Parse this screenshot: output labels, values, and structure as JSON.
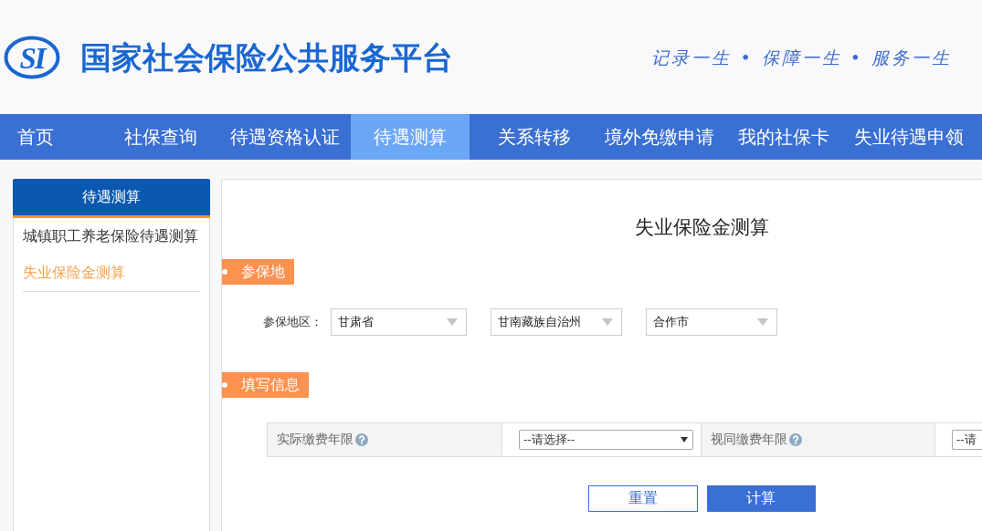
{
  "header": {
    "logo_text": "SI",
    "title": "国家社会保险公共服务平台",
    "slogan": "记录一生 • 保障一生 • 服务一生"
  },
  "nav": [
    {
      "label": "首页",
      "selected": false
    },
    {
      "label": "社保查询",
      "selected": false
    },
    {
      "label": "待遇资格认证",
      "selected": false
    },
    {
      "label": "待遇测算",
      "selected": true
    },
    {
      "label": "关系转移",
      "selected": false
    },
    {
      "label": "境外免缴申请",
      "selected": false
    },
    {
      "label": "我的社保卡",
      "selected": false
    },
    {
      "label": "失业待遇申领",
      "selected": false
    }
  ],
  "sidebar": {
    "title": "待遇测算",
    "items": [
      {
        "label": "城镇职工养老保险待遇测算",
        "selected": false
      },
      {
        "label": "失业保险金测算",
        "selected": true
      }
    ]
  },
  "main": {
    "title": "失业保险金测算",
    "sections": [
      {
        "kind": "region",
        "title": "参保地",
        "label": "参保地区：",
        "selects": [
          {
            "value": "甘肃省"
          },
          {
            "value": "甘南藏族自治州"
          },
          {
            "value": "合作市"
          }
        ]
      },
      {
        "kind": "form",
        "title": "填写信息",
        "fields": [
          {
            "label": "实际缴费年限",
            "help": true,
            "select": {
              "value": "--请选择--",
              "cut_off": false
            }
          },
          {
            "label": "视同缴费年限",
            "help": true,
            "select": {
              "value": "--请",
              "cut_off": true
            }
          }
        ]
      }
    ],
    "buttons": [
      {
        "kind": "secondary",
        "label": "重置"
      },
      {
        "kind": "primary",
        "label": "计算"
      }
    ]
  }
}
